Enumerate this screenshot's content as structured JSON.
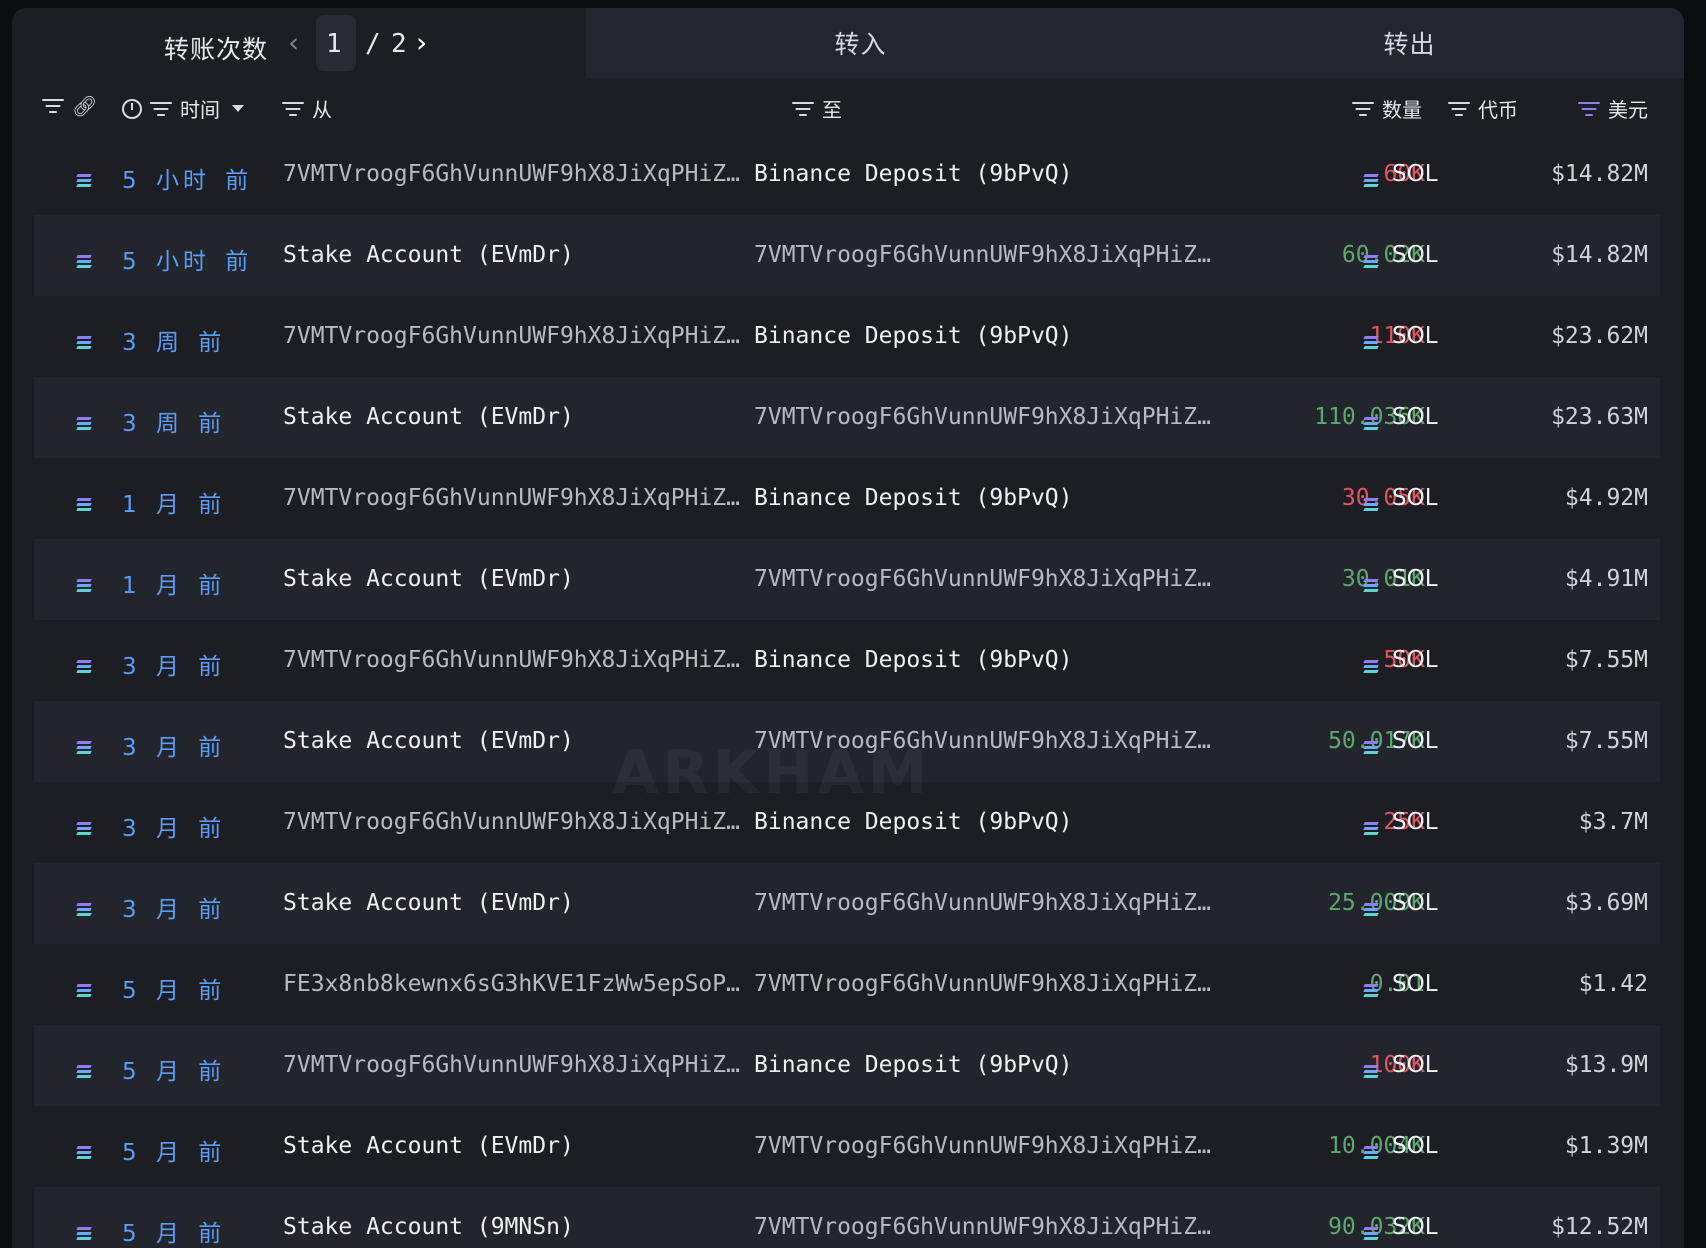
{
  "tabs": {
    "count_title": "转账次数",
    "pager": {
      "current": "1",
      "separator": "/",
      "total": "2"
    },
    "inbound": "转入",
    "outbound": "转出"
  },
  "columns": {
    "time": "时间",
    "from": "从",
    "to": "至",
    "quantity": "数量",
    "token": "代币",
    "usd": "美元"
  },
  "colors": {
    "accent": "#8a7ff5",
    "time_link": "#5b9cf6",
    "outflow": "#e2555e",
    "inflow": "#5ea86d"
  },
  "watermark": "ARKHAM",
  "rows": [
    {
      "time": "5 小时 前",
      "from": "7VMTVroogF6GhVunnUWF9hX8JiXqPHiZ…",
      "to": "Binance Deposit (9bPvQ)",
      "quantity": "60K",
      "direction": "out",
      "token": "SOL",
      "usd": "$14.82M"
    },
    {
      "time": "5 小时 前",
      "from": "Stake Account (EVmDr)",
      "to": "7VMTVroogF6GhVunnUWF9hX8JiXqPHiZ…",
      "quantity": "60.02K",
      "direction": "in",
      "token": "SOL",
      "usd": "$14.82M"
    },
    {
      "time": "3 周 前",
      "from": "7VMTVroogF6GhVunnUWF9hX8JiXqPHiZ…",
      "to": "Binance Deposit (9bPvQ)",
      "quantity": "110K",
      "direction": "out",
      "token": "SOL",
      "usd": "$23.62M"
    },
    {
      "time": "3 周 前",
      "from": "Stake Account (EVmDr)",
      "to": "7VMTVroogF6GhVunnUWF9hX8JiXqPHiZ…",
      "quantity": "110.036K",
      "direction": "in",
      "token": "SOL",
      "usd": "$23.63M"
    },
    {
      "time": "1 月 前",
      "from": "7VMTVroogF6GhVunnUWF9hX8JiXqPHiZ…",
      "to": "Binance Deposit (9bPvQ)",
      "quantity": "30.05K",
      "direction": "out",
      "token": "SOL",
      "usd": "$4.92M"
    },
    {
      "time": "1 月 前",
      "from": "Stake Account (EVmDr)",
      "to": "7VMTVroogF6GhVunnUWF9hX8JiXqPHiZ…",
      "quantity": "30.01K",
      "direction": "in",
      "token": "SOL",
      "usd": "$4.91M"
    },
    {
      "time": "3 月 前",
      "from": "7VMTVroogF6GhVunnUWF9hX8JiXqPHiZ…",
      "to": "Binance Deposit (9bPvQ)",
      "quantity": "50K",
      "direction": "out",
      "token": "SOL",
      "usd": "$7.55M"
    },
    {
      "time": "3 月 前",
      "from": "Stake Account (EVmDr)",
      "to": "7VMTVroogF6GhVunnUWF9hX8JiXqPHiZ…",
      "quantity": "50.017K",
      "direction": "in",
      "token": "SOL",
      "usd": "$7.55M"
    },
    {
      "time": "3 月 前",
      "from": "7VMTVroogF6GhVunnUWF9hX8JiXqPHiZ…",
      "to": "Binance Deposit (9bPvQ)",
      "quantity": "25K",
      "direction": "out",
      "token": "SOL",
      "usd": "$3.7M"
    },
    {
      "time": "3 月 前",
      "from": "Stake Account (EVmDr)",
      "to": "7VMTVroogF6GhVunnUWF9hX8JiXqPHiZ…",
      "quantity": "25.009K",
      "direction": "in",
      "token": "SOL",
      "usd": "$3.69M"
    },
    {
      "time": "5 月 前",
      "from": "FE3x8nb8kewnx6sG3hKVE1FzWw5epSoP…",
      "to": "7VMTVroogF6GhVunnUWF9hX8JiXqPHiZ…",
      "quantity": "0.01",
      "direction": "in",
      "token": "SOL",
      "usd": "$1.42"
    },
    {
      "time": "5 月 前",
      "from": "7VMTVroogF6GhVunnUWF9hX8JiXqPHiZ…",
      "to": "Binance Deposit (9bPvQ)",
      "quantity": "100K",
      "direction": "out",
      "token": "SOL",
      "usd": "$13.9M"
    },
    {
      "time": "5 月 前",
      "from": "Stake Account (EVmDr)",
      "to": "7VMTVroogF6GhVunnUWF9hX8JiXqPHiZ…",
      "quantity": "10.004K",
      "direction": "in",
      "token": "SOL",
      "usd": "$1.39M"
    },
    {
      "time": "5 月 前",
      "from": "Stake Account (9MNSn)",
      "to": "7VMTVroogF6GhVunnUWF9hX8JiXqPHiZ…",
      "quantity": "90.032K",
      "direction": "in",
      "token": "SOL",
      "usd": "$12.52M"
    }
  ]
}
